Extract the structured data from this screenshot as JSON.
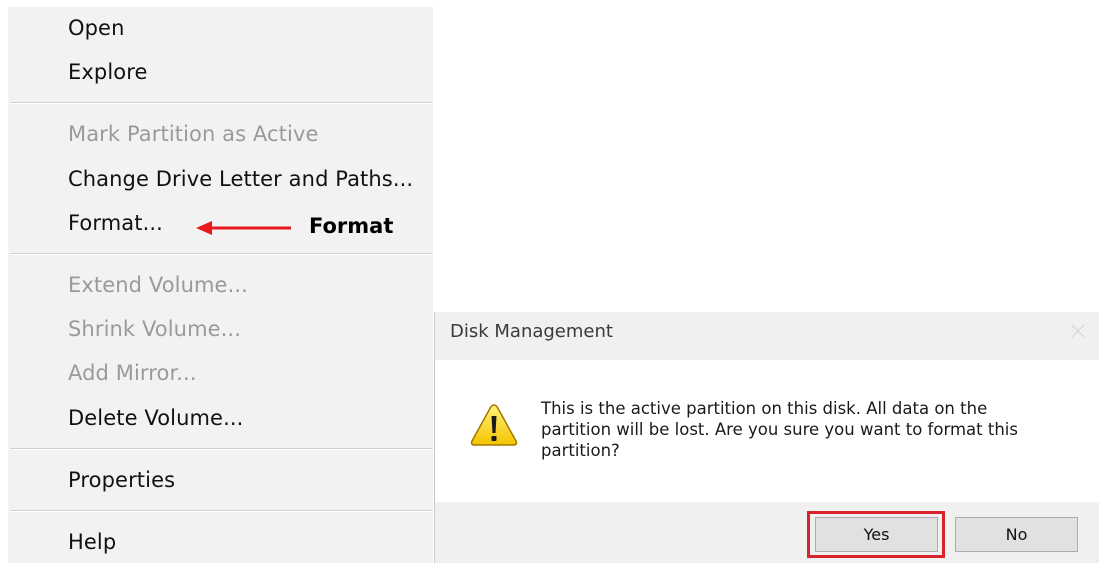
{
  "context_menu": {
    "items": [
      {
        "label": "Open",
        "enabled": true
      },
      {
        "label": "Explore",
        "enabled": true
      },
      {
        "label": "Mark Partition as Active",
        "enabled": false
      },
      {
        "label": "Change Drive Letter and Paths...",
        "enabled": true
      },
      {
        "label": "Format...",
        "enabled": true
      },
      {
        "label": "Extend Volume...",
        "enabled": false
      },
      {
        "label": "Shrink Volume...",
        "enabled": false
      },
      {
        "label": "Add Mirror...",
        "enabled": false
      },
      {
        "label": "Delete Volume...",
        "enabled": true
      },
      {
        "label": "Properties",
        "enabled": true
      },
      {
        "label": "Help",
        "enabled": true
      }
    ]
  },
  "annotation": {
    "label": "Format",
    "arrow_color": "#e8191f",
    "highlight_color": "#d8232a"
  },
  "dialog": {
    "title": "Disk Management",
    "icon": "warning-icon",
    "message_lines": [
      "This is the active partition on this disk. All data on the",
      "partition will be lost. Are you sure you want to format this",
      "partition?"
    ],
    "yes_label": "Yes",
    "no_label": "No"
  }
}
